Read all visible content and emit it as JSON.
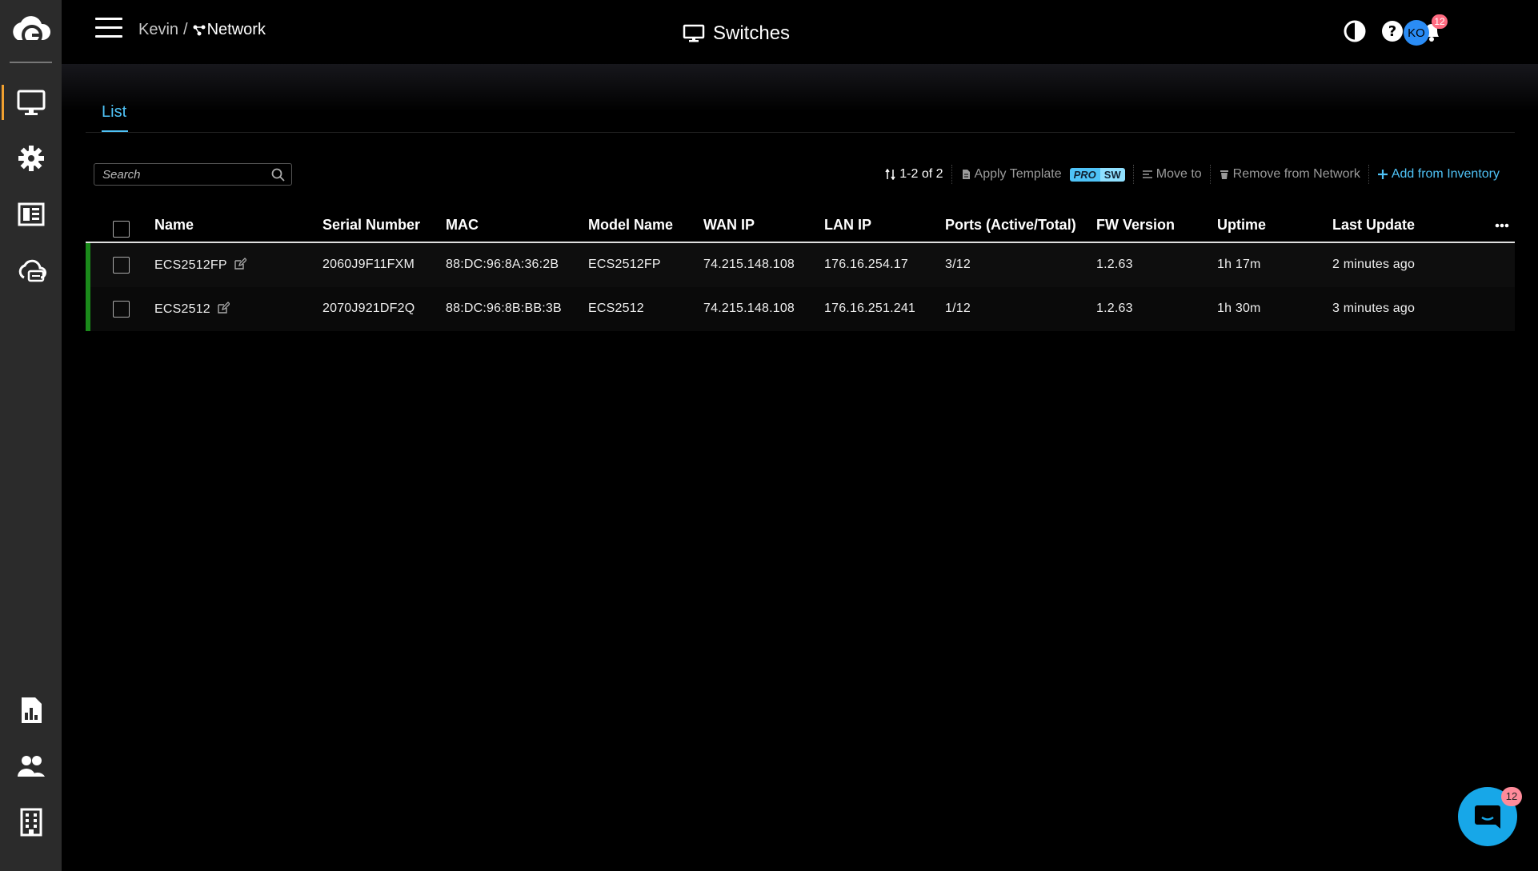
{
  "sidebar": {
    "items": [
      {
        "name": "devices",
        "icon": "monitor-icon",
        "active": true
      },
      {
        "name": "settings",
        "icon": "gear-icon",
        "active": false
      },
      {
        "name": "dashboard",
        "icon": "dashboard-icon",
        "active": false
      },
      {
        "name": "cloud",
        "icon": "cloud-sync-icon",
        "active": false
      },
      {
        "name": "reports",
        "icon": "report-icon",
        "active": false
      },
      {
        "name": "users",
        "icon": "users-icon",
        "active": false
      },
      {
        "name": "organization",
        "icon": "building-icon",
        "active": false
      }
    ]
  },
  "header": {
    "breadcrumb_user": "Kevin",
    "breadcrumb_sep": "/",
    "breadcrumb_network": "Network",
    "title": "Switches",
    "notification_count": "12",
    "avatar_initials": "KO"
  },
  "tabs": [
    {
      "label": "List",
      "active": true
    }
  ],
  "search": {
    "placeholder": "Search",
    "value": ""
  },
  "toolbar": {
    "pagination": "1-2 of 2",
    "apply_template": "Apply Template",
    "pro_label": "PRO",
    "sw_label": "SW",
    "move_to": "Move to",
    "remove": "Remove from Network",
    "add": "Add from Inventory"
  },
  "table": {
    "columns": [
      "Name",
      "Serial Number",
      "MAC",
      "Model Name",
      "WAN IP",
      "LAN IP",
      "Ports (Active/Total)",
      "FW Version",
      "Uptime",
      "Last Update"
    ],
    "rows": [
      {
        "name": "ECS2512FP",
        "serial": "2060J9F11FXM",
        "mac": "88:DC:96:8A:36:2B",
        "model": "ECS2512FP",
        "wan_ip": "74.215.148.108",
        "lan_ip": "176.16.254.17",
        "ports": "3/12",
        "fw": "1.2.63",
        "uptime": "1h 17m",
        "last_update": "2 minutes ago",
        "status": "online"
      },
      {
        "name": "ECS2512",
        "serial": "2070J921DF2Q",
        "mac": "88:DC:96:8B:BB:3B",
        "model": "ECS2512",
        "wan_ip": "74.215.148.108",
        "lan_ip": "176.16.251.241",
        "ports": "1/12",
        "fw": "1.2.63",
        "uptime": "1h 30m",
        "last_update": "3 minutes ago",
        "status": "online"
      }
    ]
  },
  "chat": {
    "badge_count": "12"
  },
  "colors": {
    "accent": "#4fc3f7",
    "online": "#1a8a1a",
    "active_nav": "#f0a030",
    "badge": "#ff6b81"
  }
}
